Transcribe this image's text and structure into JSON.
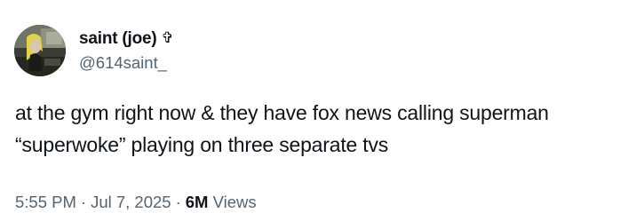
{
  "author": {
    "display_name": "saint (joe)",
    "badge_icon": "cross-icon",
    "badge_glyph": "✞",
    "handle": "@614saint_"
  },
  "tweet": {
    "line1": "at the gym right now & they have fox news calling superman",
    "line2": "“superwoke” playing on three separate tvs"
  },
  "meta": {
    "time": "5:55 PM",
    "separator": "·",
    "date": "Jul 7, 2025",
    "views_count": "6M",
    "views_label": "Views"
  },
  "colors": {
    "text": "#0f1419",
    "secondary": "#536471",
    "background": "#ffffff"
  }
}
